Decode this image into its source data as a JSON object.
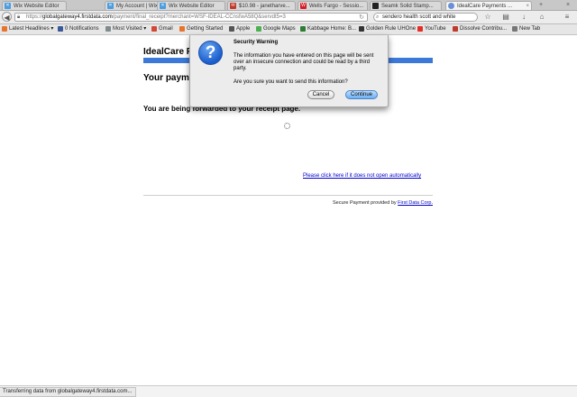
{
  "tabs": [
    {
      "label": "Wix Website Editor",
      "icon_color": "#4a9ee0",
      "icon_glyph": "x-icon"
    },
    {
      "label": "My Account | Wix.com",
      "icon_color": "#4a9ee0",
      "icon_glyph": "x-icon"
    },
    {
      "label": "Wix Website Editor",
      "icon_color": "#4a9ee0",
      "icon_glyph": "x-icon"
    },
    {
      "label": "$10.98 - janetharve...",
      "icon_color": "#c0392b",
      "icon_glyph": "mail-icon"
    },
    {
      "label": "Wells Fargo - Sessio...",
      "icon_color": "#d71e28",
      "icon_glyph": "wf-icon"
    },
    {
      "label": "Seamk Solid Stamp...",
      "icon_color": "#222222",
      "icon_glyph": "square-icon"
    },
    {
      "label": "IdealCare Payments ...",
      "icon_color": "#6a8fd6",
      "icon_glyph": "loading-icon",
      "active": true
    }
  ],
  "window": {
    "new_tab": "+",
    "close": "×"
  },
  "navbar": {
    "back_glyph": "◀",
    "url_host": "globalgateway4.firstdata.com",
    "url_scheme": "https://",
    "url_path": "/payment/final_receipt?merchant=WSF-IDEAL-CCnsfwA58Q&servdt5=3",
    "search_value": "sendero health scott and white",
    "toolbar_icons": [
      "star-icon",
      "bookmarks-icon",
      "download-icon",
      "home-icon",
      "menu-icon"
    ]
  },
  "bookmarks": [
    {
      "label": "Latest Headlines ▾",
      "color": "#e8742c"
    },
    {
      "label": "0 Notifications",
      "color": "#3b5998"
    },
    {
      "label": "Most Visited ▾",
      "color": "#7f8c8d"
    },
    {
      "label": "Gmail",
      "color": "#d44638"
    },
    {
      "label": "Getting Started",
      "color": "#e8742c"
    },
    {
      "label": "Apple",
      "color": "#555555"
    },
    {
      "label": "Google Maps",
      "color": "#4caf50"
    },
    {
      "label": "Kabbage Home: B...",
      "color": "#2e7d32"
    },
    {
      "label": "Golden Rule UHOne",
      "color": "#333333"
    },
    {
      "label": "YouTube",
      "color": "#e52d27"
    },
    {
      "label": "Dissolve Contribu...",
      "color": "#c0392b"
    },
    {
      "label": "New Tab",
      "color": "#777777"
    }
  ],
  "page": {
    "brand": "IdealCare Pa",
    "payment_msg": "Your payme",
    "forward_msg": "You are being forwarded to your receipt page.",
    "receipt_link": "Please click here if it does not open automatically",
    "secure_prefix": "Secure Payment provided by ",
    "secure_link": "First Data Corp.",
    "accent_color": "#3c78d8"
  },
  "dialog": {
    "title": "Security Warning",
    "icon": "?",
    "body": "The information you have entered on this page will be sent over an insecure connection and could be read by a third party.",
    "question": "Are you sure you want to send this information?",
    "cancel_label": "Cancel",
    "continue_label": "Continue"
  },
  "status": {
    "text": "Transferring data from globalgateway4.firstdata.com..."
  }
}
